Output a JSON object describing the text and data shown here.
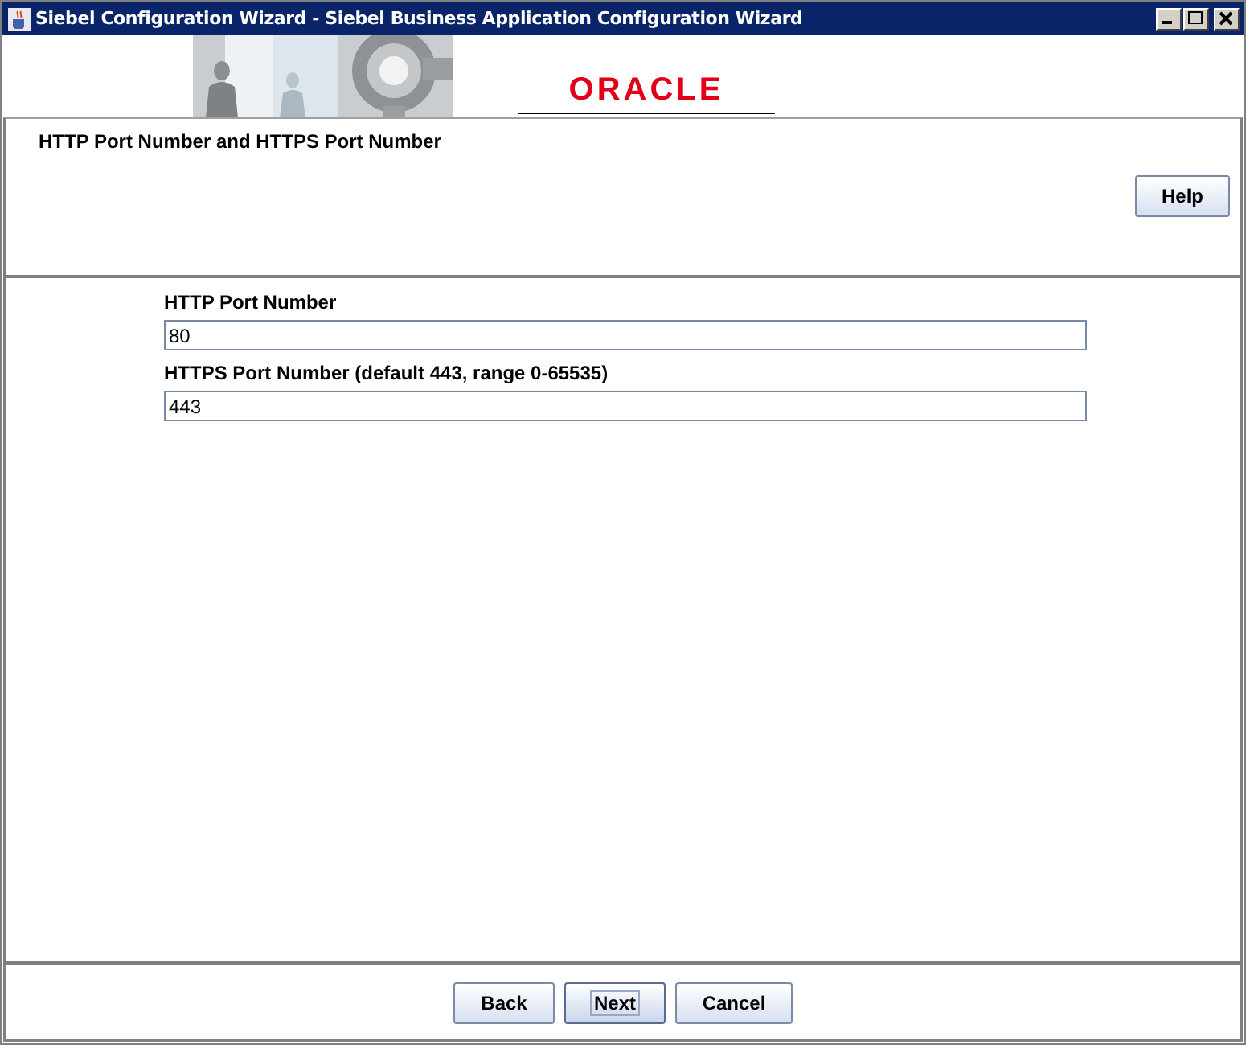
{
  "window": {
    "title": "Siebel Configuration Wizard - Siebel Business Application Configuration Wizard"
  },
  "banner": {
    "logo": "ORACLE"
  },
  "header": {
    "title": "HTTP Port Number and HTTPS Port Number",
    "help_button": "Help"
  },
  "fields": [
    {
      "label": "HTTP Port Number",
      "value": "80"
    },
    {
      "label": "HTTPS Port Number (default 443, range 0-65535)",
      "value": "443"
    }
  ],
  "buttons": [
    {
      "label": "Back",
      "focused": false
    },
    {
      "label": "Next",
      "focused": true
    },
    {
      "label": "Cancel",
      "focused": false
    }
  ]
}
